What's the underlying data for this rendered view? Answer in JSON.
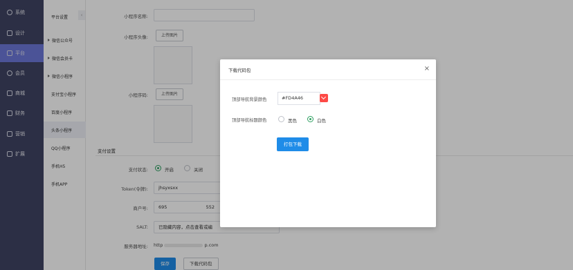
{
  "nav": {
    "items": [
      {
        "label": "系统",
        "icon": "gear-icon"
      },
      {
        "label": "设计",
        "icon": "design-icon"
      },
      {
        "label": "平台",
        "icon": "platform-icon"
      },
      {
        "label": "会员",
        "icon": "user-icon"
      },
      {
        "label": "商城",
        "icon": "shop-icon"
      },
      {
        "label": "财务",
        "icon": "finance-icon"
      },
      {
        "label": "营销",
        "icon": "marketing-icon"
      },
      {
        "label": "扩展",
        "icon": "extension-icon"
      }
    ],
    "active_index": 2
  },
  "submenu": {
    "items": [
      {
        "label": "平台设置"
      },
      {
        "label": "微信公众号"
      },
      {
        "label": "微信会员卡"
      },
      {
        "label": "微信小程序"
      },
      {
        "label": "支付宝小程序"
      },
      {
        "label": "百度小程序"
      },
      {
        "label": "头条小程序"
      },
      {
        "label": "QQ小程序"
      },
      {
        "label": "手机H5"
      },
      {
        "label": "手机APP"
      }
    ],
    "collapse_icon": "chevron-left-icon"
  },
  "form": {
    "name_label": "小程序名称:",
    "avatar_label": "小程序头像:",
    "upload_label": "上传图片",
    "qrcode_label": "小程序码:",
    "qrcode_upload_label": "上传图片",
    "pay_section_title": "支付设置",
    "pay_status_label": "支付状态:",
    "pay_on_label": "开启",
    "pay_off_label": "关闭",
    "token_label": "Token(令牌):",
    "token_value": "jhsyxsxx",
    "merchant_label": "商户号:",
    "merchant_value": "695",
    "merchant_value_tail": "552",
    "salt_label": "SALT:",
    "salt_value": "已隐藏内容，点击查看或编",
    "server_label": "服务器地址:",
    "server_value_head": "http",
    "server_value_tail": "p.com",
    "save_label": "保存",
    "download_label": "下载代码包"
  },
  "modal": {
    "title": "下载代码包",
    "close_glyph": "×",
    "bg_color_label": "顶部导航背景颜色",
    "bg_color_value": "#FD4A46",
    "title_color_label": "顶部导航标题颜色",
    "title_black_label": "黑色",
    "title_white_label": "白色",
    "build_button_label": "打包下载"
  },
  "colors": {
    "nav_bg": "#3f4463",
    "nav_active": "#6c77d8",
    "primary": "#1f8ce8",
    "radio_checked": "#2d9f60",
    "swatch": "#FD4A46"
  }
}
